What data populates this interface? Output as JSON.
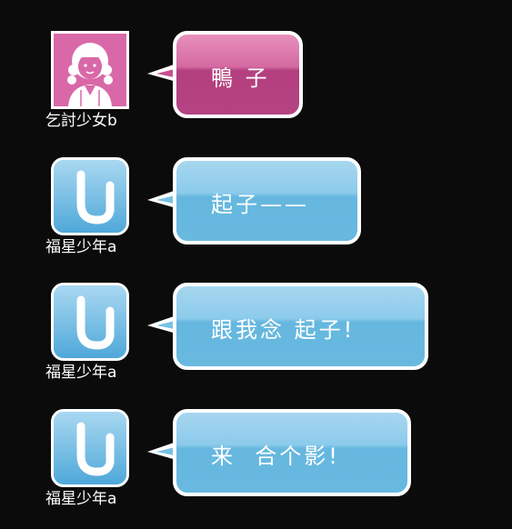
{
  "messages": [
    {
      "sender": "乞討少女b",
      "avatar": "girl-avatar",
      "text": "鴨 子",
      "bubble_color": "#b54382"
    },
    {
      "sender": "福星少年a",
      "avatar": "blue-u-avatar",
      "text": "起子——",
      "bubble_color": "#68b9e0"
    },
    {
      "sender": "福星少年a",
      "avatar": "blue-u-avatar",
      "text": "跟我念 起子!",
      "bubble_color": "#68b9e0"
    },
    {
      "sender": "福星少年a",
      "avatar": "blue-u-avatar",
      "text": "来  合个影!",
      "bubble_color": "#68b9e0"
    }
  ]
}
